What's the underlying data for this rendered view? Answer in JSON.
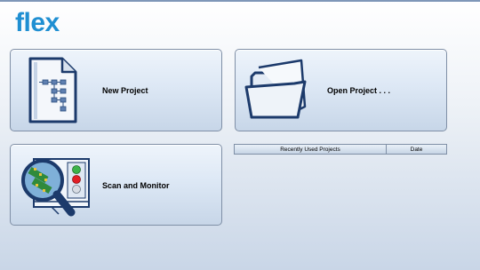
{
  "app": {
    "logo_text": "flex"
  },
  "tiles": {
    "new_project": {
      "label": "New Project",
      "icon": "flowchart-document-icon"
    },
    "open_project": {
      "label": "Open Project . . .",
      "icon": "folder-icon"
    },
    "scan_monitor": {
      "label": "Scan and Monitor",
      "icon": "magnifier-circuit-board-icon"
    }
  },
  "recent_projects": {
    "columns": [
      "Recently Used Projects",
      "Date"
    ],
    "rows": []
  },
  "colors": {
    "logo": "#1f8fd2",
    "tile_border": "#7f8fa6",
    "icon_navy": "#1c3a6b"
  }
}
